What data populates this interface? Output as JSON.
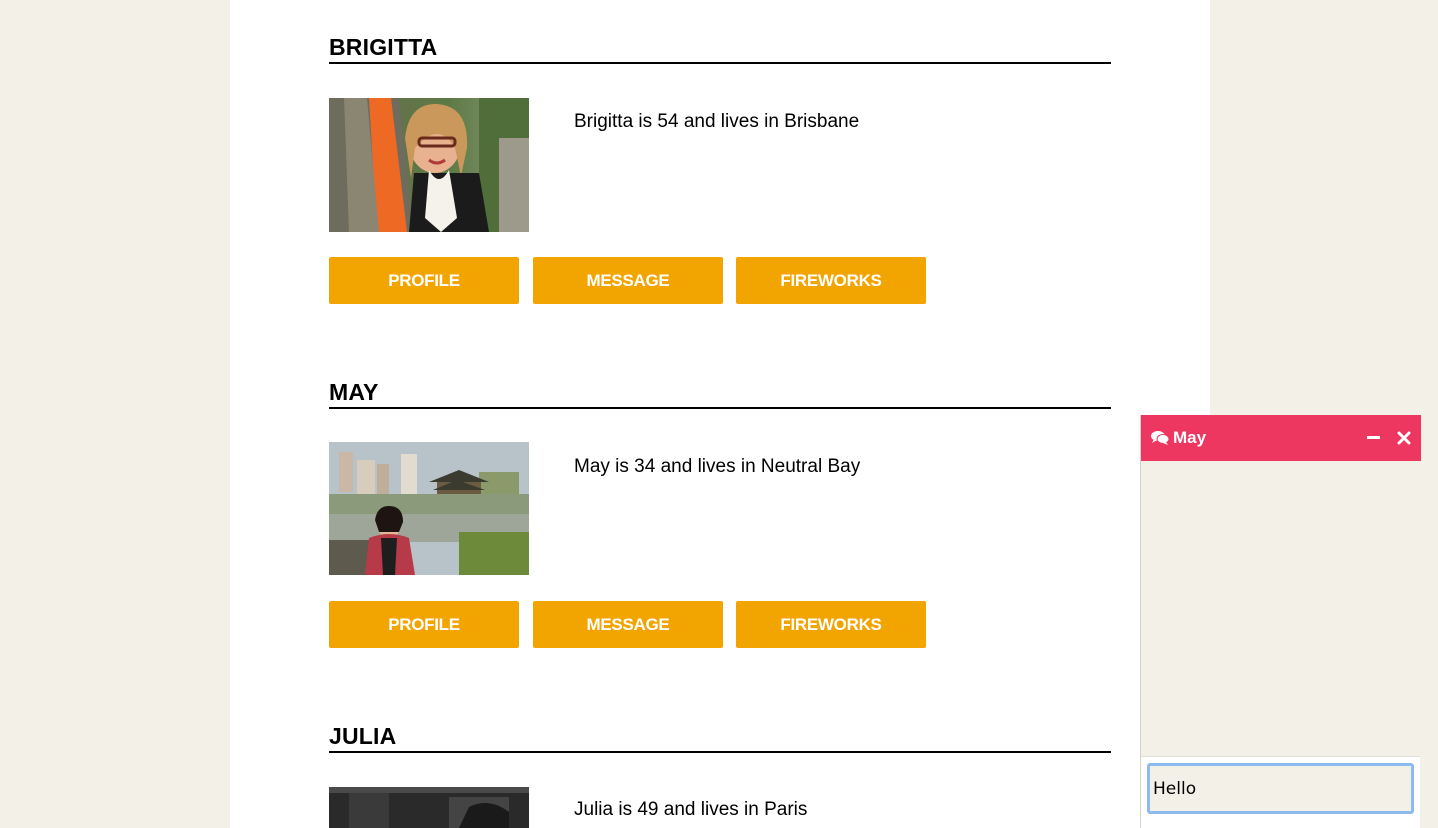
{
  "members": [
    {
      "name": "BRIGITTA",
      "description": "Brigitta is 54 and lives in Brisbane",
      "buttons": {
        "profile": "PROFILE",
        "message": "MESSAGE",
        "fireworks": "FIREWORKS"
      }
    },
    {
      "name": "MAY",
      "description": "May is 34 and lives in Neutral Bay",
      "buttons": {
        "profile": "PROFILE",
        "message": "MESSAGE",
        "fireworks": "FIREWORKS"
      }
    },
    {
      "name": "JULIA",
      "description": "Julia is 49 and lives in Paris"
    }
  ],
  "chat": {
    "title": "May",
    "input_value": "Hello",
    "icons": {
      "chat": "comments-icon",
      "minimize": "minimize-icon",
      "close": "close-icon"
    }
  },
  "colors": {
    "button": "#f2a500",
    "chat_header": "#ee3760",
    "page_background": "#f3f0e8"
  }
}
